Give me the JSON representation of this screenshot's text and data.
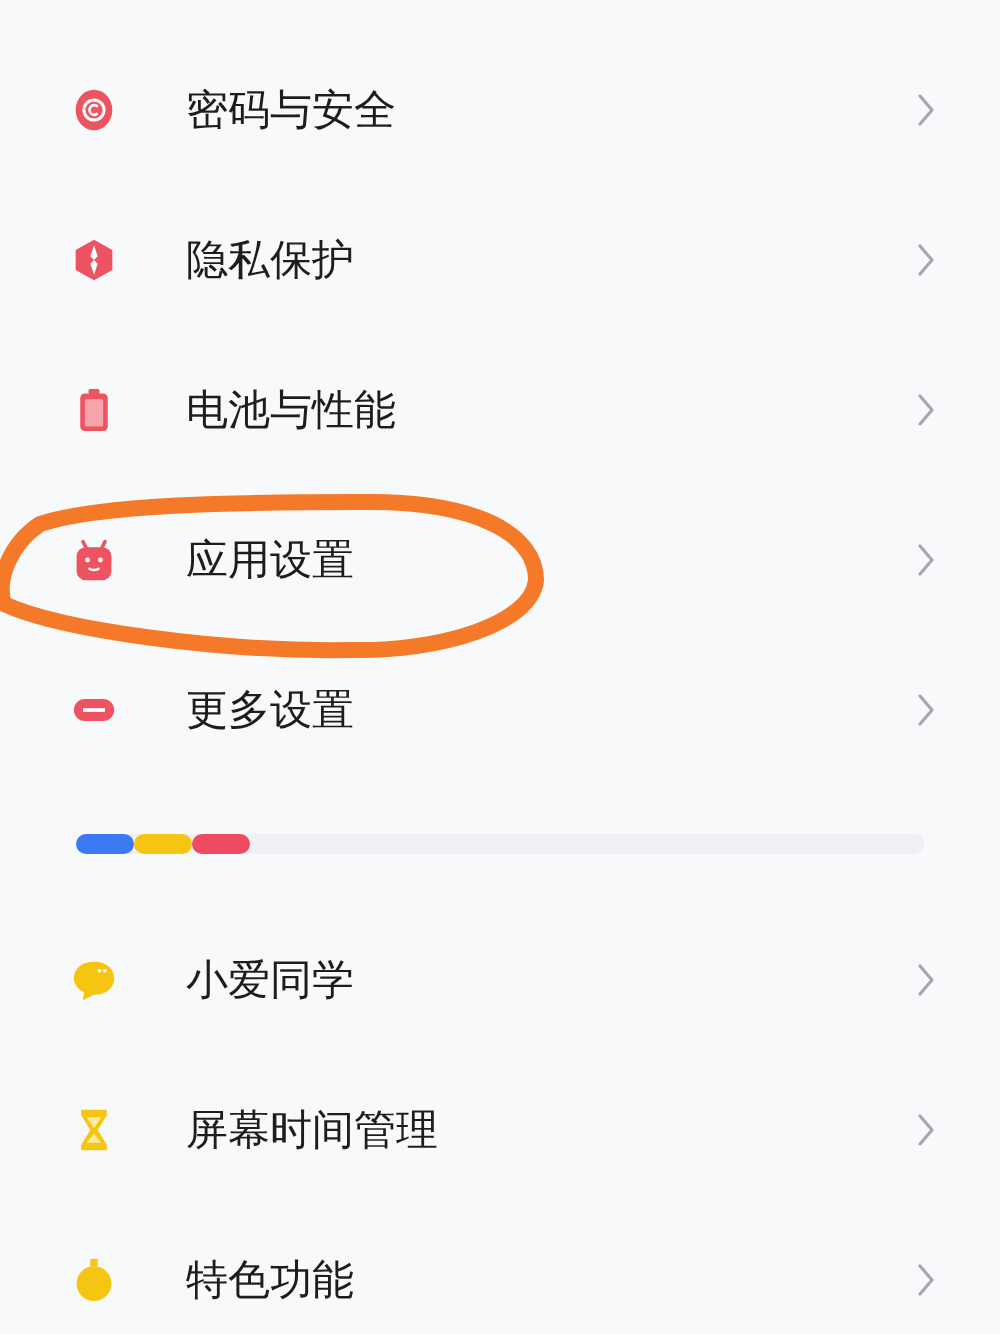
{
  "groups": [
    {
      "items": [
        {
          "label": "密码与安全",
          "kind": "lock",
          "color": "#ee5361"
        },
        {
          "label": "隐私保护",
          "kind": "shield",
          "color": "#ee5361"
        },
        {
          "label": "电池与性能",
          "kind": "battery",
          "color": "#ee5361"
        },
        {
          "label": "应用设置",
          "kind": "android",
          "color": "#ee5361"
        },
        {
          "label": "更多设置",
          "kind": "pill",
          "color": "#ee5361"
        }
      ]
    },
    {
      "items": [
        {
          "label": "小爱同学",
          "kind": "chat",
          "color": "#f6c512"
        },
        {
          "label": "屏幕时间管理",
          "kind": "hourglass",
          "color": "#f6c512"
        },
        {
          "label": "特色功能",
          "kind": "flask",
          "color": "#f6c512"
        }
      ]
    }
  ],
  "divider": {
    "segments": [
      {
        "color": "#3b7af2"
      },
      {
        "color": "#f6c512"
      },
      {
        "color": "#ee4a62"
      }
    ]
  },
  "annotation": {
    "kind": "circle",
    "color": "#f47a2a"
  }
}
